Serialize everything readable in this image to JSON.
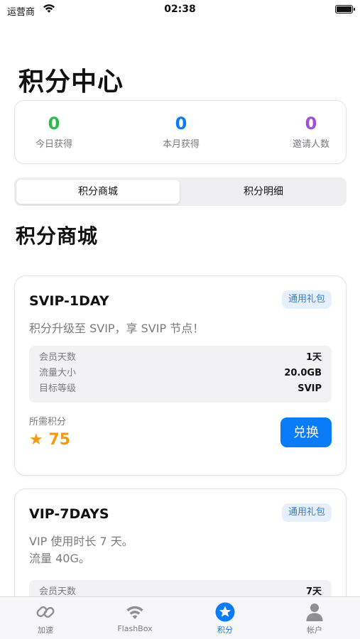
{
  "status": {
    "carrier": "运营商",
    "time": "02:38"
  },
  "page_title": "积分中心",
  "stats": [
    {
      "value": "0",
      "label": "今日获得",
      "color": "#2fb94c"
    },
    {
      "value": "0",
      "label": "本月获得",
      "color": "#0a7cf7"
    },
    {
      "value": "0",
      "label": "邀请人数",
      "color": "#a04fd8"
    }
  ],
  "segments": [
    "积分商城",
    "积分明细"
  ],
  "section_title": "积分商城",
  "products": [
    {
      "name": "SVIP-1DAY",
      "badge": "通用礼包",
      "desc": "积分升级至 SVIP，享 SVIP 节点！",
      "info": [
        {
          "key": "会员天数",
          "value": "1天"
        },
        {
          "key": "流量大小",
          "value": "20.0GB"
        },
        {
          "key": "目标等级",
          "value": "SVIP"
        }
      ],
      "cost_label": "所需积分",
      "cost": "★ 75",
      "button": "兑换"
    },
    {
      "name": "VIP-7DAYS",
      "badge": "通用礼包",
      "desc_line1": "VIP 使用时长 7 天。",
      "desc_line2": "流量 40G。",
      "info": [
        {
          "key": "会员天数",
          "value": "7天"
        }
      ]
    }
  ],
  "tabs": [
    {
      "label": "加速",
      "icon": "link-icon"
    },
    {
      "label": "FlashBox",
      "icon": "wifi-icon"
    },
    {
      "label": "积分",
      "icon": "star-icon"
    },
    {
      "label": "帐户",
      "icon": "person-icon"
    }
  ],
  "colors": {
    "accent": "#0a7cf7",
    "points": "#f59a0f",
    "badge_bg": "#e6f0fc"
  }
}
